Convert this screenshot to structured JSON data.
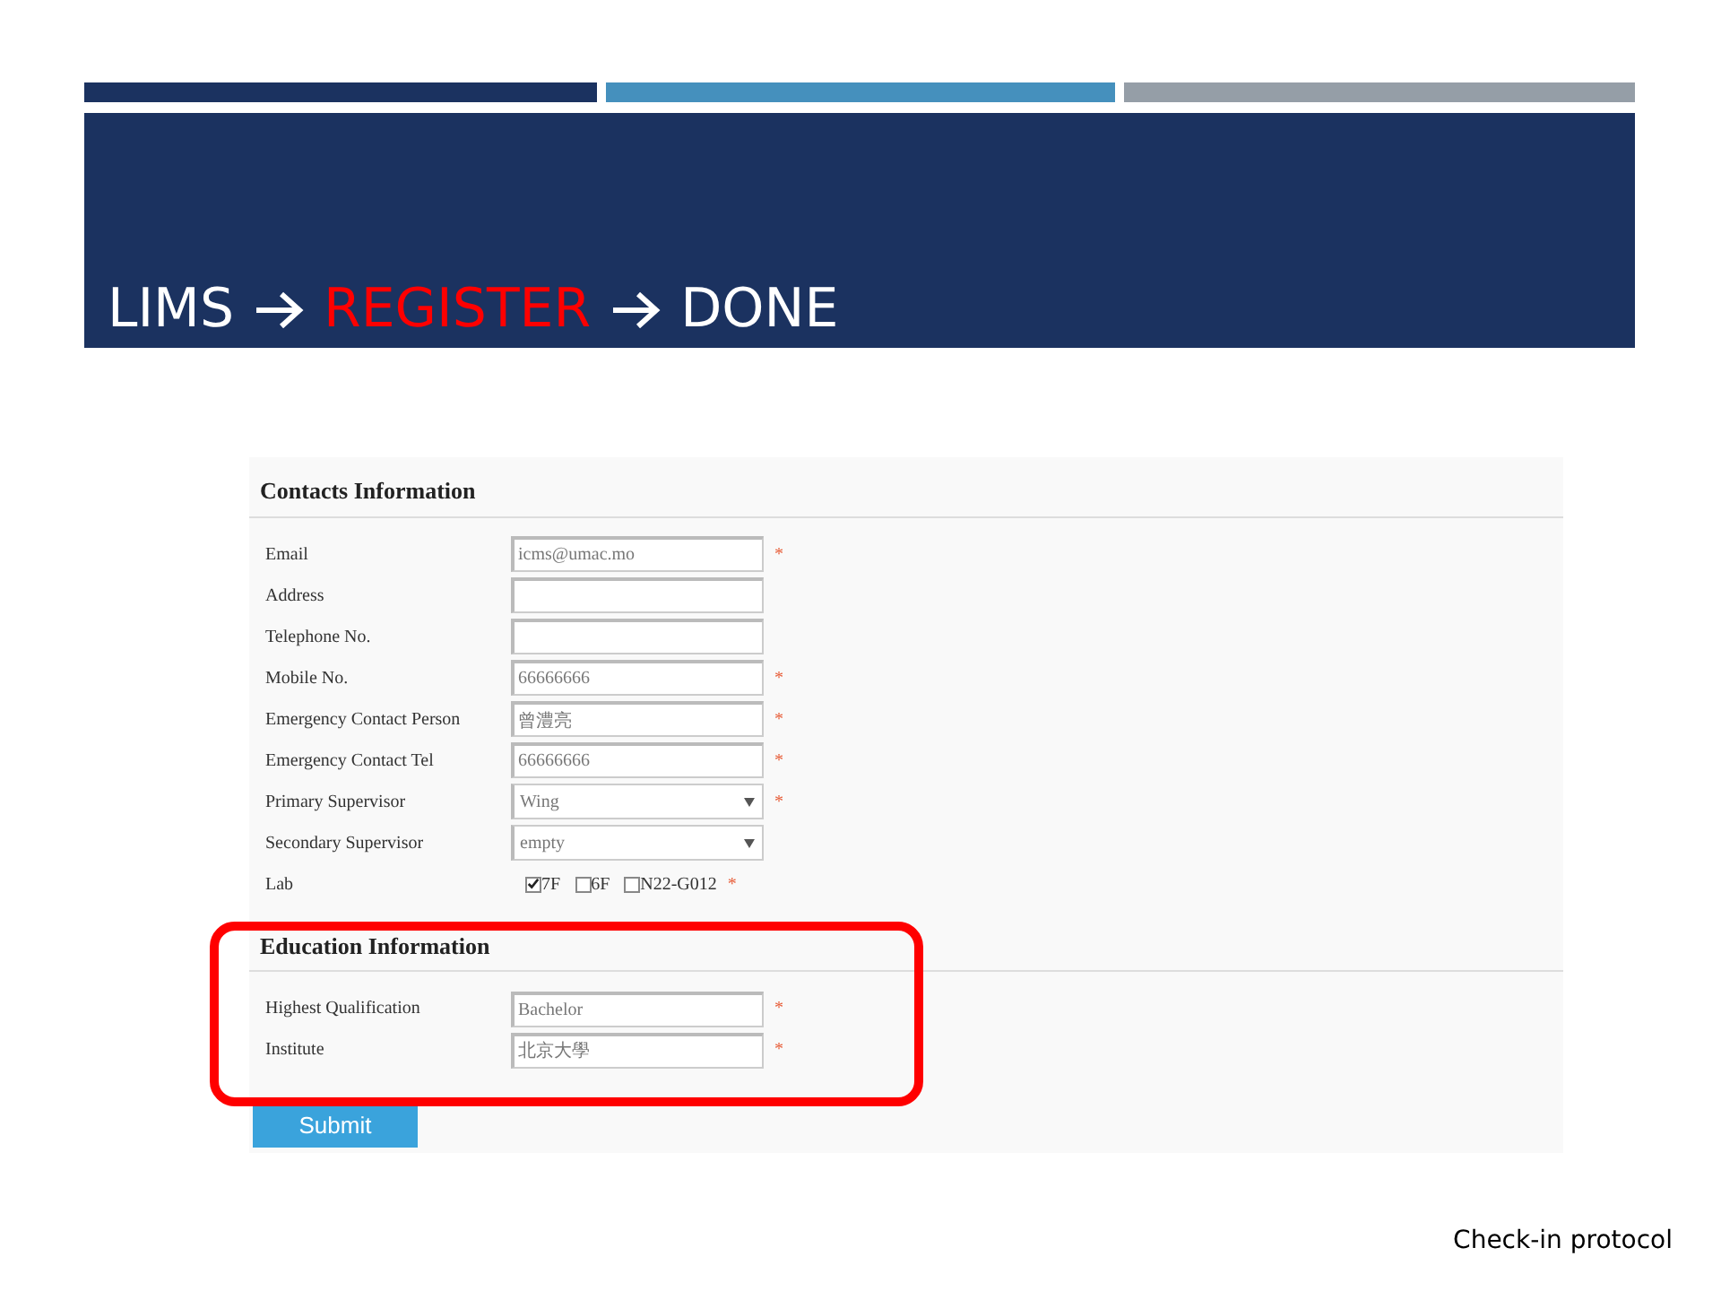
{
  "title_steps": [
    {
      "label": "LIMS",
      "selected": false
    },
    {
      "label": "REGISTER",
      "selected": true
    },
    {
      "label": "DONE",
      "selected": false
    }
  ],
  "sections": [
    {
      "title": "Contacts Information",
      "fields": [
        {
          "label": "Email",
          "kind": "text",
          "value": "icms@umac.mo",
          "required_mark": "*"
        },
        {
          "label": "Address",
          "kind": "text"
        },
        {
          "label": "Telephone No.",
          "kind": "text"
        },
        {
          "label": "Mobile No.",
          "kind": "text",
          "value": "66666666",
          "required_mark": "*"
        },
        {
          "label": "Emergency Contact Person",
          "kind": "text",
          "value": "曾澧亮",
          "required_mark": "*"
        },
        {
          "label": "Emergency Contact Tel",
          "kind": "text",
          "value": "66666666",
          "required_mark": "*"
        },
        {
          "label": "Primary Supervisor",
          "kind": "select",
          "value": "Wing",
          "required_mark": "*"
        },
        {
          "label": "Secondary Supervisor",
          "kind": "select",
          "value": "empty"
        },
        {
          "label": "Lab",
          "kind": "checkboxes",
          "required_mark": "*",
          "options": [
            {
              "label": "7F",
              "checked": true
            },
            {
              "label": "6F",
              "checked": false
            },
            {
              "label": "N22-G012",
              "checked": false
            }
          ]
        }
      ]
    },
    {
      "title": "Education Information",
      "highlighted": true,
      "fields": [
        {
          "label": "Highest Qualification",
          "kind": "text",
          "value": "Bachelor",
          "required_mark": "*"
        },
        {
          "label": "Institute",
          "kind": "text",
          "value": "北京大學",
          "required_mark": "*"
        }
      ]
    }
  ],
  "submit": "Submit",
  "footer": "Check-in protocol"
}
